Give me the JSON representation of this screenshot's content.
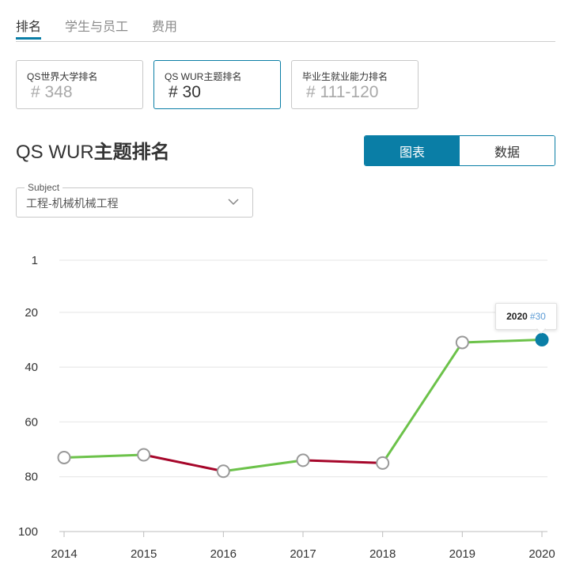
{
  "tabs": [
    {
      "label": "排名",
      "active": true
    },
    {
      "label": "学生与员工",
      "active": false
    },
    {
      "label": "费用",
      "active": false
    }
  ],
  "cards": [
    {
      "label": "QS世界大学排名",
      "value": "# 348",
      "active": false
    },
    {
      "label": "QS WUR主题排名",
      "value": "# 30",
      "active": true
    },
    {
      "label": "毕业生就业能力排名",
      "value": "# 111-120",
      "active": false
    }
  ],
  "section": {
    "title_prefix": "QS WUR",
    "title_bold": "主题排名"
  },
  "toggle": {
    "chart_label": "图表",
    "data_label": "数据",
    "active": "chart"
  },
  "subject": {
    "legend": "Subject",
    "value": "工程-机械机械工程",
    "icon": "chevron-down-icon"
  },
  "colors": {
    "accent": "#0a7ea6",
    "up": "#6cc24a",
    "down": "#a6062a",
    "marker_stroke": "#999999"
  },
  "tooltip": {
    "year": "2020",
    "rank": "#30"
  },
  "chart_data": {
    "type": "line",
    "title": "",
    "xlabel": "",
    "ylabel": "",
    "x": [
      "2014",
      "2015",
      "2016",
      "2017",
      "2018",
      "2019",
      "2020"
    ],
    "series": [
      {
        "values": [
          73,
          72,
          78,
          74,
          75,
          31,
          30
        ]
      }
    ],
    "y_ticks": [
      "1",
      "20",
      "40",
      "60",
      "80",
      "100"
    ],
    "ylim": [
      1,
      100
    ],
    "y_inverted": true,
    "grid": true,
    "highlight": {
      "x": "2020",
      "value": 30
    },
    "segment_coloring": "green when rank improves or is flat, dark red when rank worsens"
  }
}
